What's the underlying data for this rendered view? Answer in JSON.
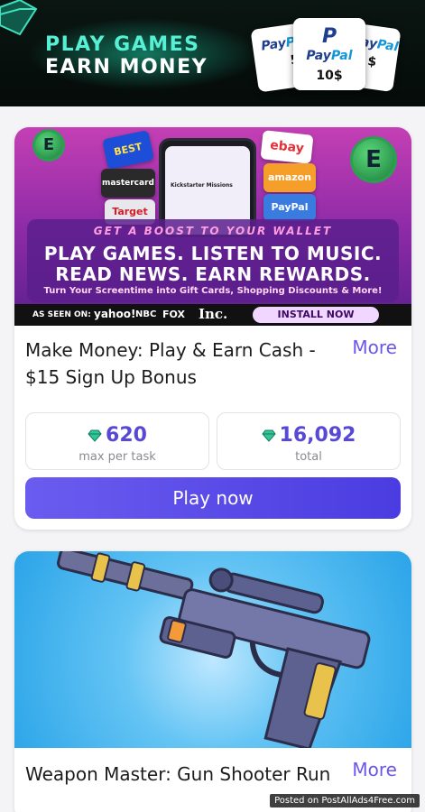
{
  "header": {
    "line1": "PLAY GAMES",
    "line2": "EARN MONEY",
    "cards": [
      {
        "brand_a": "Pay",
        "brand_b": "Pal",
        "amount": "5$"
      },
      {
        "brand_a": "Pay",
        "brand_b": "Pal",
        "amount": "10$"
      },
      {
        "brand_a": "Pay",
        "brand_b": "Pal",
        "amount": "$"
      }
    ]
  },
  "offers": [
    {
      "banner": {
        "boost": "GET A BOOST TO YOUR WALLET",
        "headline1": "PLAY GAMES. LISTEN TO MUSIC.",
        "headline2": "READ NEWS. EARN REWARDS.",
        "subline": "Turn Your Screentime into Gift Cards, Shopping Discounts & More!",
        "seen_on": "AS SEEN ON:",
        "media": [
          "yahoo!",
          "NBC",
          "FOX",
          "Inc."
        ],
        "install": "INSTALL NOW",
        "gift_cards": [
          "BEST BUY",
          "mastercard",
          "Target",
          "ebay",
          "amazon",
          "PayPal"
        ],
        "phone_label": "Kickstarter Missions"
      },
      "title": "Make Money: Play & Earn Cash - $15 Sign Up Bonus",
      "more": "More",
      "stats": [
        {
          "value": "620",
          "label": "max per task"
        },
        {
          "value": "16,092",
          "label": "total"
        }
      ],
      "cta": "Play now"
    },
    {
      "title": "Weapon Master: Gun Shooter Run",
      "more": "More"
    }
  ],
  "watermark": "Posted on PostAllAds4Free.com",
  "colors": {
    "accent": "#5749d6",
    "button": "#5a4be8",
    "header_teal": "#57f0d4"
  }
}
